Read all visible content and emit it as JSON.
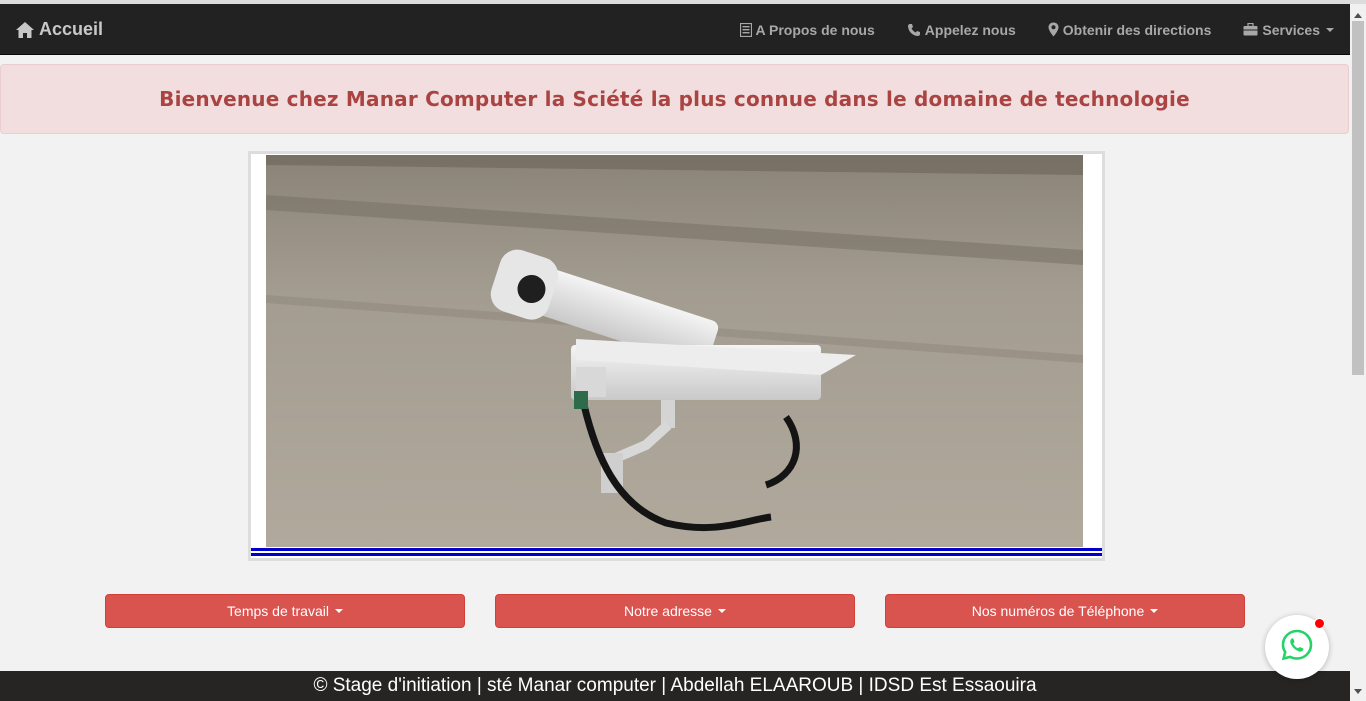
{
  "navbar": {
    "brand": {
      "icon": "home-icon",
      "label": "Accueil"
    },
    "links": [
      {
        "icon": "list-icon",
        "label": "A Propos de nous"
      },
      {
        "icon": "phone-icon",
        "label": "Appelez nous"
      },
      {
        "icon": "map-marker-icon",
        "label": "Obtenir des directions"
      },
      {
        "icon": "briefcase-icon",
        "label": "Services",
        "dropdown": true
      }
    ]
  },
  "alert": {
    "text": "Bienvenue chez Manar Computer la Sciété la plus connue dans le domaine de technologie"
  },
  "carousel": {
    "image": "security-cameras-photo"
  },
  "buttons": [
    {
      "label": "Temps de travail"
    },
    {
      "label": "Notre adresse"
    },
    {
      "label": "Nos numéros de Téléphone"
    }
  ],
  "footer": {
    "text": "© Stage d'initiation | sté Manar computer | Abdellah ELAAROUB | IDSD Est Essaouira"
  },
  "whatsapp": {
    "icon": "whatsapp-icon"
  },
  "colors": {
    "navbar_bg": "#222222",
    "alert_bg": "#f2dede",
    "alert_text": "#a94442",
    "button_bg": "#d9534f",
    "footer_bg": "#272424",
    "whatsapp_green": "#25d366",
    "carousel_indicator": "#0000cc"
  }
}
